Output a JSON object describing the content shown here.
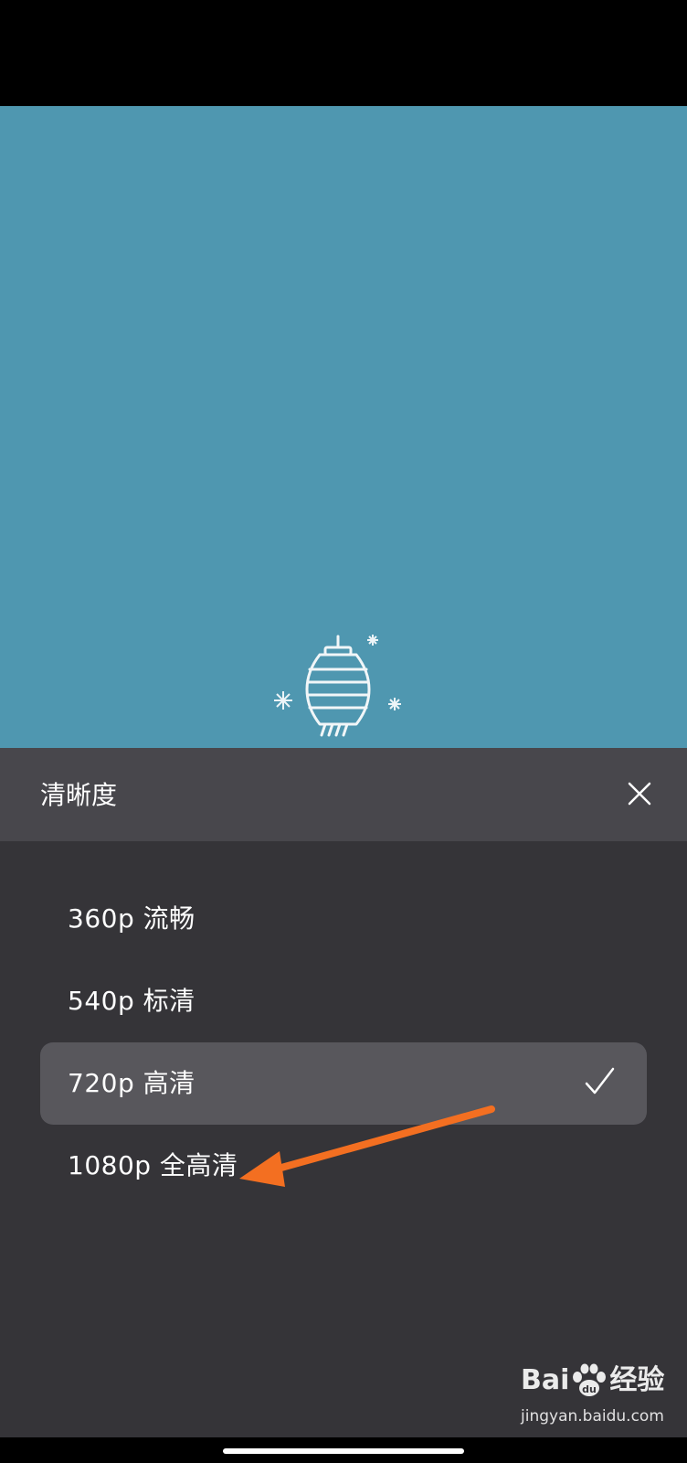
{
  "panel": {
    "title": "清晰度",
    "options": [
      {
        "label": "360p 流畅",
        "selected": false
      },
      {
        "label": "540p 标清",
        "selected": false
      },
      {
        "label": "720p 高清",
        "selected": true
      },
      {
        "label": "1080p 全高清",
        "selected": false
      }
    ]
  },
  "icons": {
    "close": "close-icon",
    "check": "checkmark-icon",
    "lantern": "lantern-icon"
  },
  "colors": {
    "video_background": "#4f97b0",
    "panel_header": "#48474c",
    "panel_background": "#353438",
    "selected_option": "#58575c",
    "annotation_arrow": "#f36f21"
  },
  "watermark": {
    "brand_left": "Bai",
    "brand_right": "经验",
    "url": "jingyan.baidu.com"
  }
}
